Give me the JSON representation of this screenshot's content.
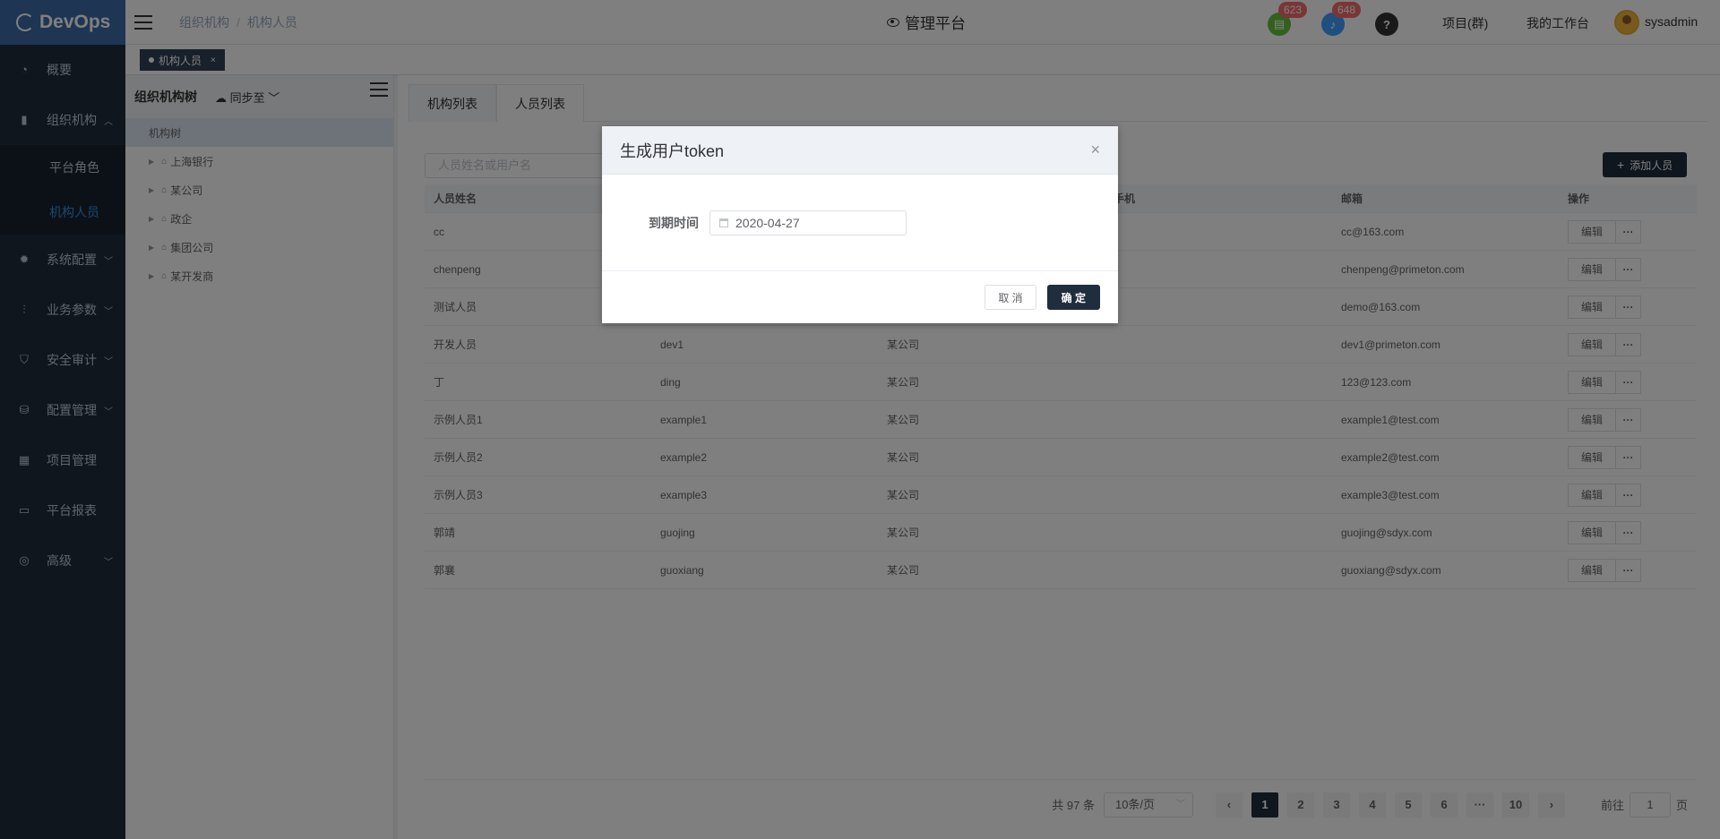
{
  "app": {
    "logo": "DevOps"
  },
  "sidebar": {
    "items": [
      {
        "label": "概要",
        "icon": "dashboard-icon"
      },
      {
        "label": "组织机构",
        "icon": "lock-icon",
        "expanded": true,
        "children": [
          {
            "label": "平台角色"
          },
          {
            "label": "机构人员",
            "active": true
          }
        ]
      },
      {
        "label": "系统配置",
        "icon": "gear-icon"
      },
      {
        "label": "业务参数",
        "icon": "sliders-icon"
      },
      {
        "label": "安全审计",
        "icon": "shield-icon"
      },
      {
        "label": "配置管理",
        "icon": "database-icon"
      },
      {
        "label": "项目管理",
        "icon": "grid-icon"
      },
      {
        "label": "平台报表",
        "icon": "monitor-icon"
      },
      {
        "label": "高级",
        "icon": "fingerprint-icon"
      }
    ]
  },
  "header": {
    "breadcrumb": [
      "组织机构",
      "机构人员"
    ],
    "platform_title": "管理平台",
    "task_badge": "623",
    "notify_badge": "648",
    "help": "?",
    "projects_link": "项目(群)",
    "workspace_link": "我的工作台",
    "username": "sysadmin"
  },
  "tagsbar": {
    "active_tag": "机构人员",
    "close": "×"
  },
  "tree": {
    "title": "组织机构树",
    "sync_label": "同步至",
    "root": "机构树",
    "nodes": [
      "上海银行",
      "某公司",
      "政企",
      "集团公司",
      "某开发商"
    ]
  },
  "main": {
    "tabs": [
      "机构列表",
      "人员列表"
    ],
    "search_placeholder": "人员姓名或用户名",
    "add_button": "添加人员",
    "columns": [
      "人员姓名",
      "",
      "",
      "手机",
      "邮箱",
      "操作"
    ],
    "rows": [
      {
        "name": "cc",
        "user": "",
        "org": "",
        "phone": "",
        "email": "cc@163.com"
      },
      {
        "name": "chenpeng",
        "user": "",
        "org": "",
        "phone": "",
        "email": "chenpeng@primeton.com"
      },
      {
        "name": "测试人员",
        "user": "",
        "org": "",
        "phone": "",
        "email": "demo@163.com"
      },
      {
        "name": "开发人员",
        "user": "dev1",
        "org": "某公司",
        "phone": "",
        "email": "dev1@primeton.com"
      },
      {
        "name": "丁",
        "user": "ding",
        "org": "某公司",
        "phone": "",
        "email": "123@123.com"
      },
      {
        "name": "示例人员1",
        "user": "example1",
        "org": "某公司",
        "phone": "",
        "email": "example1@test.com"
      },
      {
        "name": "示例人员2",
        "user": "example2",
        "org": "某公司",
        "phone": "",
        "email": "example2@test.com"
      },
      {
        "name": "示例人员3",
        "user": "example3",
        "org": "某公司",
        "phone": "",
        "email": "example3@test.com"
      },
      {
        "name": "郭靖",
        "user": "guojing",
        "org": "某公司",
        "phone": "",
        "email": "guojing@sdyx.com"
      },
      {
        "name": "郭襄",
        "user": "guoxiang",
        "org": "某公司",
        "phone": "",
        "email": "guoxiang@sdyx.com"
      }
    ],
    "edit_label": "编辑",
    "more_label": "···"
  },
  "pager": {
    "total": "共 97 条",
    "page_size": "10条/页",
    "pages": [
      "1",
      "2",
      "3",
      "4",
      "5",
      "6",
      "···",
      "10"
    ],
    "current": "1",
    "prev": "‹",
    "next": "›",
    "goto_label": "前往",
    "goto_value": "1",
    "goto_suffix": "页"
  },
  "dialog": {
    "title": "生成用户token",
    "close": "×",
    "field_label": "到期时间",
    "date_value": "2020-04-27",
    "cancel": "取 消",
    "confirm": "确 定"
  },
  "colors": {
    "sidebar_bg": "#1f2d3d",
    "logo_bg": "#3c6aa6",
    "active": "#3a8ee6",
    "primary_btn": "#1f2d3d"
  }
}
